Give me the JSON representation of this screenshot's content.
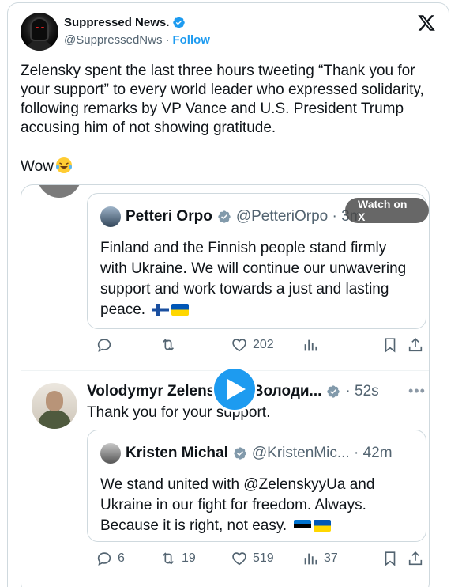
{
  "post": {
    "display_name": "Suppressed News.",
    "handle": "@SuppressedNws",
    "separator": "·",
    "follow_label": "Follow",
    "text": "Zelensky spent the last three hours tweeting “Thank you for your support” to every world leader who expressed solidarity, following remarks by VP Vance and U.S. President Trump accusing him of not showing gratitude.",
    "text_end": "Wow"
  },
  "media": {
    "watch_label": "Watch on X",
    "quote1": {
      "name": "Petteri Orpo",
      "handle": "@PetteriOrpo · 3m",
      "body": "Finland and the Finnish people stand firmly with Ukraine. We will continue our unwavering support and work towards a just and lasting peace."
    },
    "actions1": {
      "replies": "",
      "reposts": "",
      "likes": "202",
      "views": ""
    },
    "reply": {
      "name": "Volodymyr Zelenskyy / Володи...",
      "time": "· 52s",
      "more": "•••",
      "text": "Thank you for your support."
    },
    "quote2": {
      "name": "Kristen Michal",
      "handle": "@KristenMic... · 42m",
      "body": "We stand united with @ZelenskyyUa and Ukraine in our fight for freedom. Always. Because it is right, not easy."
    },
    "actions2": {
      "replies": "6",
      "reposts": "19",
      "likes": "519",
      "views": "37"
    }
  },
  "colors": {
    "accent": "#1d9bf0",
    "text": "#0f1419",
    "muted": "#536471",
    "border": "#cfd9de"
  },
  "icons": [
    "verified-badge-icon",
    "x-logo-icon",
    "reply-icon",
    "repost-icon",
    "like-icon",
    "views-icon",
    "bookmark-icon",
    "share-icon",
    "play-icon",
    "laughing-emoji-icon",
    "finland-flag-icon",
    "ukraine-flag-icon",
    "estonia-flag-icon"
  ]
}
